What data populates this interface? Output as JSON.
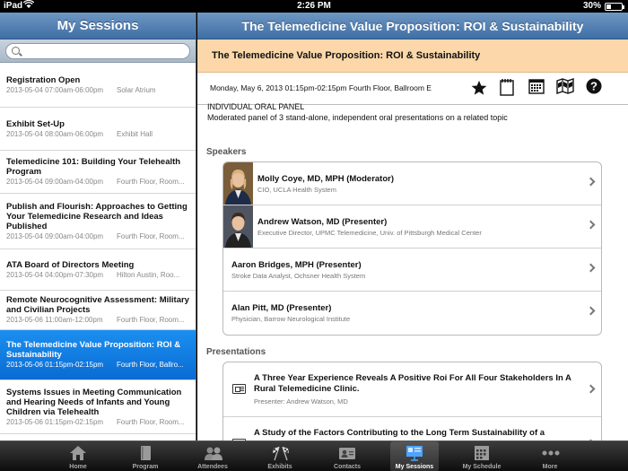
{
  "status_bar": {
    "carrier": "iPad",
    "time": "2:26 PM",
    "battery": "30%",
    "battery_level": 0.3
  },
  "left_pane": {
    "title": "My Sessions",
    "search_placeholder": "",
    "sessions": [
      {
        "title": "Registration Open",
        "date": "2013-05-04",
        "time": "07:00am-06:00pm",
        "location": "Solar Atrium",
        "selected": false
      },
      {
        "title": "Exhibit Set-Up",
        "date": "2013-05-04",
        "time": "08:00am-06:00pm",
        "location": "Exhibit Hall",
        "selected": false
      },
      {
        "title": "Telemedicine 101: Building Your Telehealth Program",
        "date": "2013-05-04",
        "time": "09:00am-04:00pm",
        "location": "Fourth Floor, Room...",
        "selected": false
      },
      {
        "title": "Publish and Flourish:  Approaches to Getting Your Telemedicine Research and Ideas Published",
        "date": "2013-05-04",
        "time": "09:00am-04:00pm",
        "location": "Fourth Floor, Room...",
        "selected": false
      },
      {
        "title": "ATA Board of Directors Meeting",
        "date": "2013-05-04",
        "time": "04:00pm-07:30pm",
        "location": "Hilton Austin, Roo...",
        "selected": false
      },
      {
        "title": "Remote Neurocognitive Assessment: Military and Civilian Projects",
        "date": "2013-05-06",
        "time": "11:00am-12:00pm",
        "location": "Fourth Floor, Room...",
        "selected": false
      },
      {
        "title": "The Telemedicine Value Proposition:  ROI & Sustainability",
        "date": "2013-05-06",
        "time": "01:15pm-02:15pm",
        "location": "Fourth Floor, Ballro...",
        "selected": true
      },
      {
        "title": "Systems Issues in Meeting Communication and Hearing Needs of Infants and Young Children via Telehealth",
        "date": "2013-05-06",
        "time": "01:15pm-02:15pm",
        "location": "Fourth Floor, Room...",
        "selected": false
      }
    ]
  },
  "detail": {
    "header_title": "The Telemedicine Value Proposition:  ROI & Sustainability",
    "title": "The Telemedicine Value Proposition:  ROI & Sustainability",
    "datetime": "Monday, May 6, 2013  01:15pm-02:15pm  Fourth Floor, Ballroom E",
    "session_type": "INDIVIDUAL ORAL PANEL",
    "description": "Moderated panel of 3 stand-alone, independent oral presentations on a related topic",
    "action_icons": [
      "star-icon",
      "notes-icon",
      "calendar-icon",
      "map-icon",
      "help-icon"
    ],
    "speakers_label": "Speakers",
    "speakers": [
      {
        "name": "Molly Coye, MD, MPH (Moderator)",
        "role": "CIO, UCLA Health System",
        "has_photo": true
      },
      {
        "name": "Andrew Watson, MD (Presenter)",
        "role": "Executive Director, UPMC Telemedicine, Univ. of Pittsburgh Medical Center",
        "has_photo": true
      },
      {
        "name": "Aaron Bridges, MPH (Presenter)",
        "role": "Stroke Data Analyst, Ochsner Health System",
        "has_photo": false
      },
      {
        "name": "Alan Pitt, MD (Presenter)",
        "role": "Physician, Barrow Neurological Institute",
        "has_photo": false
      }
    ],
    "presentations_label": "Presentations",
    "presentations": [
      {
        "title": "A Three Year Experience Reveals A Positive Roi For All Four Stakeholders In A Rural Telemedicine Clinic.",
        "presenter": "Presenter: Andrew Watson, MD"
      },
      {
        "title": "A Study of the Factors Contributing to the Long Term Sustainability of a",
        "presenter": ""
      }
    ]
  },
  "tab_bar": {
    "tabs": [
      {
        "label": "Home",
        "icon": "home-icon",
        "active": false
      },
      {
        "label": "Program",
        "icon": "book-icon",
        "active": false
      },
      {
        "label": "Attendees",
        "icon": "people-icon",
        "active": false
      },
      {
        "label": "Exhibits",
        "icon": "flags-icon",
        "active": false
      },
      {
        "label": "Contacts",
        "icon": "contact-card-icon",
        "active": false
      },
      {
        "label": "My Sessions",
        "icon": "presentation-icon",
        "active": true
      },
      {
        "label": "My Schedule",
        "icon": "calendar-icon",
        "active": false
      },
      {
        "label": "More",
        "icon": "more-icon",
        "active": false
      }
    ]
  },
  "colors": {
    "header_blue": "#4f7db1",
    "title_band": "#fbd7aa",
    "selected_blue": "#1281e6",
    "tab_bar": "#1c1c1c"
  }
}
